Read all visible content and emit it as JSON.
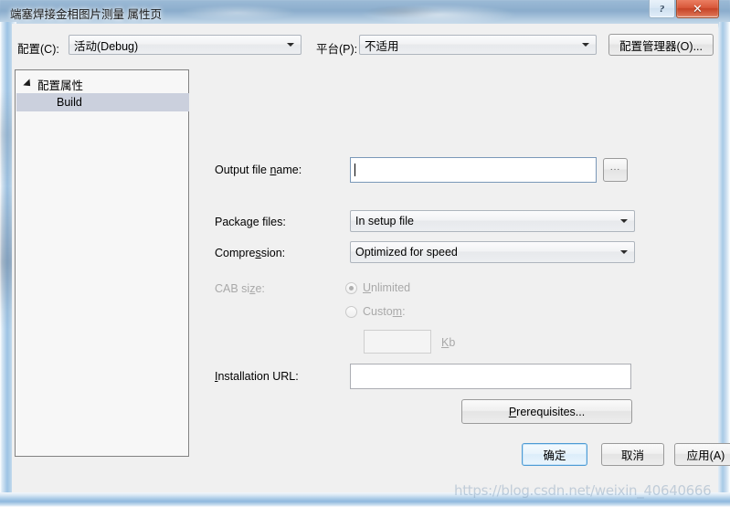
{
  "window": {
    "title": "端塞焊接金相图片测量 属性页",
    "caption_buttons": {
      "help_label": "?",
      "close_label": "✕"
    }
  },
  "config_bar": {
    "configuration_label": "配置(C):",
    "configuration_value": "活动(Debug)",
    "platform_label": "平台(P):",
    "platform_value": "不适用",
    "config_manager_label": "配置管理器(O)..."
  },
  "tree": {
    "root_label": "配置属性",
    "child_label": "Build"
  },
  "form": {
    "output_file_name_label": "Output file name:",
    "output_file_name_value": "",
    "browse_label": "...",
    "package_files_label": "Package files:",
    "package_files_value": "In setup file",
    "compression_label": "Compression:",
    "compression_value": "Optimized for speed",
    "cab_size_label": "CAB size:",
    "cab_unlimited_label": "Unlimited",
    "cab_custom_label": "Custom:",
    "cab_size_value": "",
    "cab_units_label": "Kb",
    "installation_url_label": "Installation URL:",
    "installation_url_value": "",
    "prerequisites_label": "Prerequisites..."
  },
  "footer": {
    "ok_label": "确定",
    "cancel_label": "取消",
    "apply_label": "应用(A)"
  },
  "watermark": {
    "text": "https://blog.csdn.net/weixin_40640666"
  },
  "colors": {
    "dialog_bg": "#f0f0f0",
    "glass": "#a8cae6",
    "selection": "#cbd0dd",
    "close_button": "#c64326",
    "default_button_border": "#4e9bd4",
    "disabled_text": "#a9a9a9"
  }
}
